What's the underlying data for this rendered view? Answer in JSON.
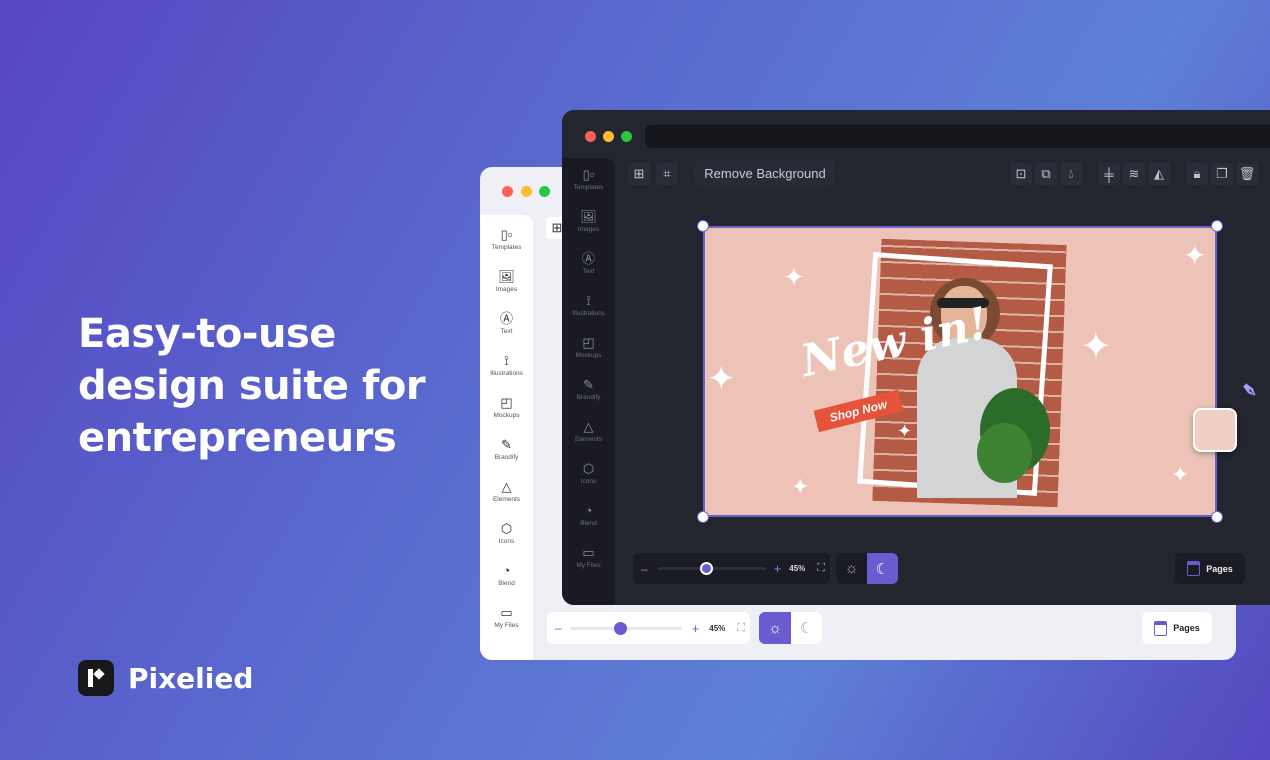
{
  "headline": {
    "line1": "Easy-to-use",
    "line2": "design suite for",
    "line3": "entrepreneurs"
  },
  "brand": {
    "name": "Pixelied"
  },
  "sidebar": {
    "items": [
      {
        "label": "Templates",
        "icon": "templates-icon",
        "glyph": "▯▫"
      },
      {
        "label": "Images",
        "icon": "image-icon",
        "glyph": "🖼"
      },
      {
        "label": "Text",
        "icon": "text-icon",
        "glyph": "Ⓐ"
      },
      {
        "label": "Illustrations",
        "icon": "illustrations-icon",
        "glyph": "⟟"
      },
      {
        "label": "Mockups",
        "icon": "mockups-icon",
        "glyph": "◰"
      },
      {
        "label": "Brandify",
        "icon": "wand-icon",
        "glyph": "✎"
      },
      {
        "label": "Elements",
        "icon": "shapes-icon",
        "glyph": "△"
      },
      {
        "label": "Icons",
        "icon": "cube-icon",
        "glyph": "⬡"
      },
      {
        "label": "Blend",
        "icon": "palette-icon",
        "glyph": "◔"
      },
      {
        "label": "My Files",
        "icon": "folder-icon",
        "glyph": "▭"
      }
    ]
  },
  "toolbar": {
    "remove_bg_label": "Remove Background"
  },
  "canvas_content": {
    "headline": "New in!",
    "cta": "Shop Now"
  },
  "zoom": {
    "value_label": "45%",
    "level_percent": 45,
    "minus": "–",
    "plus": "+"
  },
  "pages": {
    "label": "Pages"
  },
  "theme": {
    "dark_window_mode": "dark",
    "light_window_mode": "light"
  },
  "colors": {
    "accent": "#6a5cd0",
    "canvas_bg": "#ecc3b6",
    "dark_bg": "#23252f",
    "light_bg": "#eef0f5",
    "swatch": "#f0cfc4"
  }
}
